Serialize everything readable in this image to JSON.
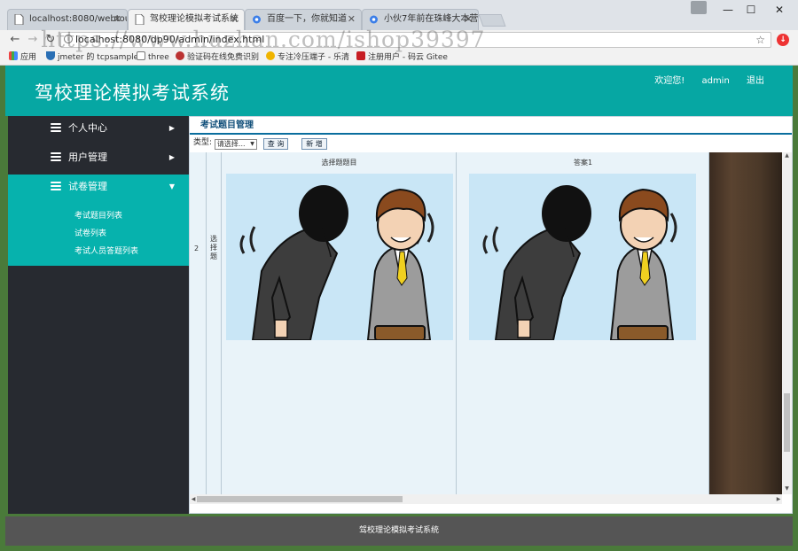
{
  "browser": {
    "tabs": [
      {
        "title": "localhost:8080/webtou",
        "active": false
      },
      {
        "title": "驾校理论模拟考试系统",
        "active": true
      },
      {
        "title": "百度一下，你就知道",
        "active": false
      },
      {
        "title": "小伙7年前在珠峰大本营",
        "active": false
      }
    ],
    "url": "localhost:8080/dp90/admin/index.html",
    "bookmarks": [
      "应用",
      "jmeter 的 tcpsample",
      "three",
      "验证码在线免费识别",
      "专注冷压端子 - 乐清",
      "注册用户 - 码云 Gitee"
    ],
    "watermark": "https://www.huzhan.com/ishop39397"
  },
  "header": {
    "title": "驾校理论模拟考试系统",
    "welcome": "欢迎您!",
    "username": "admin",
    "logout": "退出"
  },
  "sidebar": {
    "menus": [
      {
        "label": "个人中心",
        "open": false
      },
      {
        "label": "用户管理",
        "open": false
      },
      {
        "label": "试卷管理",
        "open": true
      }
    ],
    "subitems": [
      "考试题目列表",
      "试卷列表",
      "考试人员答题列表"
    ]
  },
  "main": {
    "breadcrumb": "考试题目管理",
    "filter": {
      "type_label": "类型:",
      "select_value": "请选择...",
      "query_button": "查 询",
      "add_button": "新 增"
    },
    "table": {
      "columns": [
        "选择题题目",
        "答案1"
      ],
      "row": {
        "index": "2",
        "type": "选择题"
      }
    }
  },
  "footer": {
    "text": "驾校理论模拟考试系统"
  },
  "colors": {
    "teal": "#06a7a3",
    "sidebar": "#272a30",
    "footer": "#555555"
  }
}
